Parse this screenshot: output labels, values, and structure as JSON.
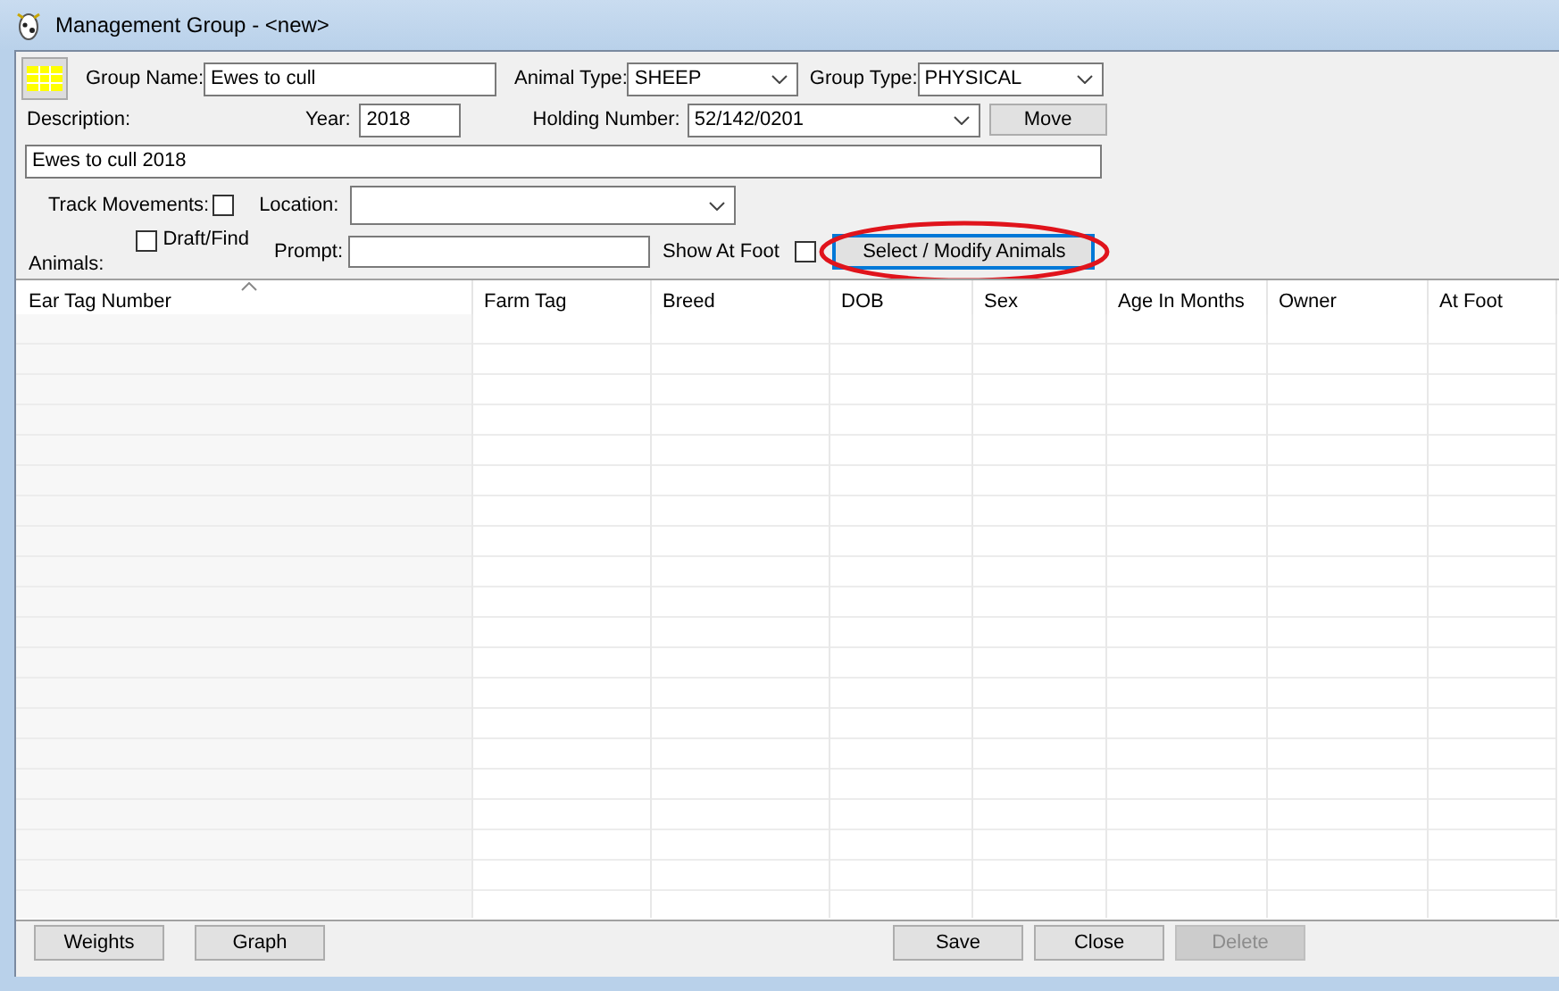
{
  "window": {
    "title": "Management Group - <new>"
  },
  "form": {
    "group_name_label": "Group Name:",
    "group_name": "Ewes to cull",
    "animal_type_label": "Animal Type:",
    "animal_type": "SHEEP",
    "group_type_label": "Group Type:",
    "group_type": "PHYSICAL",
    "description_label": "Description:",
    "year_label": "Year:",
    "year": "2018",
    "holding_number_label": "Holding Number:",
    "holding_number": "52/142/0201",
    "move_button": "Move",
    "description": "Ewes to cull 2018",
    "track_movements_label": "Track Movements:",
    "track_movements": {
      "checked": false
    },
    "location_label": "Location:",
    "animals_label": "Animals:",
    "draft_find": {
      "label": "Draft/Find",
      "checked": false
    },
    "prompt_label": "Prompt:",
    "show_at_foot_label": "Show At Foot",
    "show_at_foot": {
      "checked": false
    },
    "select_button": "Select / Modify Animals"
  },
  "table": {
    "columns": [
      "Ear Tag Number",
      "Farm Tag",
      "Breed",
      "DOB",
      "Sex",
      "Age In Months",
      "Owner",
      "At Foot"
    ]
  },
  "footer": {
    "left_buttons": [
      {
        "label": "Weights",
        "disabled": false
      },
      {
        "label": "Graph",
        "disabled": false
      }
    ],
    "right_buttons": [
      {
        "label": "Save",
        "disabled": false
      },
      {
        "label": "Close",
        "disabled": false
      },
      {
        "label": "Delete",
        "disabled": true
      }
    ]
  }
}
